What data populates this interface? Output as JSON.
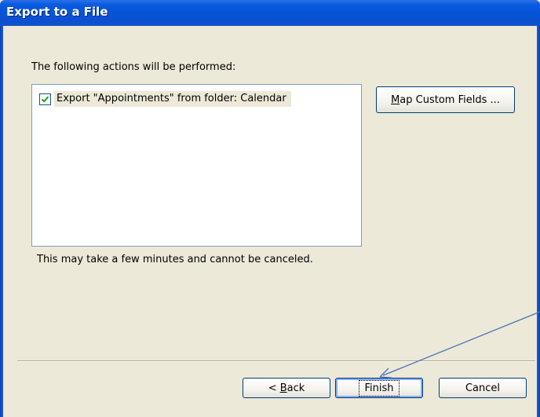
{
  "window": {
    "title": "Export to a File"
  },
  "main": {
    "actions_label": "The following actions will be performed:",
    "actions": [
      {
        "checked": true,
        "label": "Export \"Appointments\" from folder: Calendar"
      }
    ],
    "note": "This may take a few minutes and cannot be canceled.",
    "map_button": {
      "accel": "M",
      "rest": "ap Custom Fields ..."
    }
  },
  "footer": {
    "back": {
      "prefix": "< ",
      "accel": "B",
      "rest": "ack"
    },
    "finish": "Finish",
    "cancel": "Cancel"
  },
  "colors": {
    "titlebar": "#0654d6",
    "dialog_bg": "#ece9d8",
    "annotation_arrow": "#4a72b8"
  },
  "icons": [
    "checkmark-icon",
    "annotation-arrow"
  ]
}
